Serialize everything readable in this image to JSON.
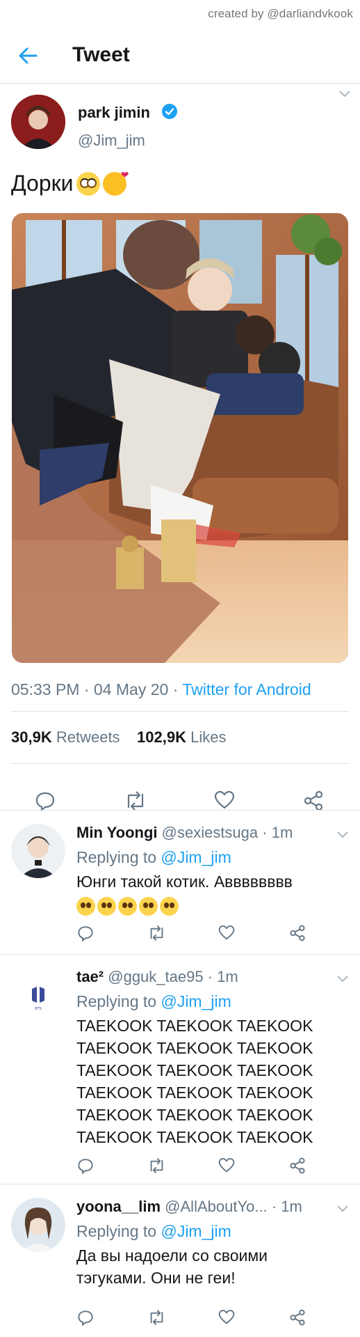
{
  "watermark": "created by @darliandvkook",
  "header": {
    "title": "Tweet",
    "back_icon": "arrow-left-icon"
  },
  "colors": {
    "accent": "#1da1f2",
    "secondary_text": "#657786",
    "verified": "#1da1f2"
  },
  "main_tweet": {
    "author_name": "park jimin",
    "handle": "@Jim_jim",
    "text": "Дорки",
    "time": "05:33 PM",
    "date": "04 May 20",
    "source": "Twitter for Android",
    "retweets_count": "30,9K",
    "retweets_label": "Retweets",
    "likes_count": "102,9K",
    "likes_label": "Likes"
  },
  "replies": [
    {
      "name": "Min Yoongi",
      "handle": "@sexiestsuga",
      "time": "1m",
      "replying_label": "Replying to",
      "replying_to": "@Jim_jim",
      "text": "Юнги такой котик. Авввввввв"
    },
    {
      "name": "tae²",
      "handle": "@gguk_tae95",
      "time": "1m",
      "replying_label": "Replying to",
      "replying_to": "@Jim_jim",
      "lines": [
        "TAEKOOK TAEKOOK TAEKOOK",
        "TAEKOOK TAEKOOK TAEKOOK",
        "TAEKOOK TAEKOOK TAEKOOK",
        "TAEKOOK TAEKOOK TAEKOOK",
        "TAEKOOK TAEKOOK TAEKOOK",
        "TAEKOOK TAEKOOK TAEKOOK"
      ]
    },
    {
      "name": "yoona__lim",
      "handle": "@AllAboutYo...",
      "time": "1m",
      "replying_label": "Replying to",
      "replying_to": "@Jim_jim",
      "line1": "Да вы надоели со своими",
      "line2": "тэгуками. Они не геи!"
    }
  ]
}
